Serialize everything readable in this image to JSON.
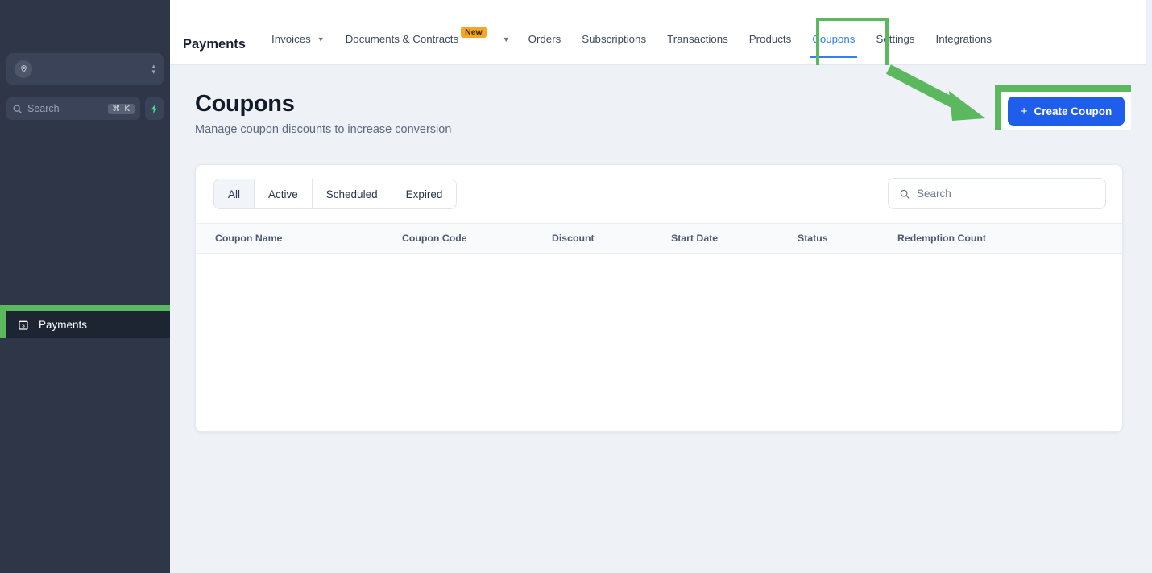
{
  "sidebar": {
    "workspace": {
      "avatar_icon": "location-pin-avatar-icon",
      "value": ""
    },
    "search": {
      "placeholder": "Search",
      "shortcut": "⌘ K",
      "icon": "search-icon"
    },
    "quick_action": {
      "icon": "lightning-bolt-icon"
    },
    "items": [
      {
        "label": "Payments",
        "icon": "payments-bill-icon",
        "active": true
      }
    ]
  },
  "topnav": {
    "brand": "Payments",
    "items": [
      {
        "label": "Invoices",
        "has_chevron": true
      },
      {
        "label": "Documents & Contracts",
        "badge": "New",
        "has_chevron": false
      },
      {
        "label": "",
        "chevron_only": true
      },
      {
        "label": "Orders"
      },
      {
        "label": "Subscriptions"
      },
      {
        "label": "Transactions"
      },
      {
        "label": "Products"
      },
      {
        "label": "Coupons",
        "active": true
      },
      {
        "label": "Settings"
      },
      {
        "label": "Integrations"
      }
    ]
  },
  "page": {
    "title": "Coupons",
    "subtitle": "Manage coupon discounts to increase conversion",
    "create_button": {
      "label": "Create Coupon",
      "icon": "plus-icon"
    }
  },
  "filters": {
    "tabs": [
      {
        "label": "All",
        "selected": true
      },
      {
        "label": "Active",
        "selected": false
      },
      {
        "label": "Scheduled",
        "selected": false
      },
      {
        "label": "Expired",
        "selected": false
      }
    ]
  },
  "table_search": {
    "placeholder": "Search",
    "icon": "search-icon",
    "value": ""
  },
  "table": {
    "columns": [
      "Coupon Name",
      "Coupon Code",
      "Discount",
      "Start Date",
      "Status",
      "Redemption Count"
    ],
    "rows": []
  },
  "colors": {
    "sidebar_bg": "#2e3648",
    "page_bg": "#eef2f6",
    "accent_blue": "#1f5eeb",
    "active_tab_blue": "#2f80f5",
    "annotation_green": "#5cb85f",
    "badge_orange": "#f5a623"
  }
}
